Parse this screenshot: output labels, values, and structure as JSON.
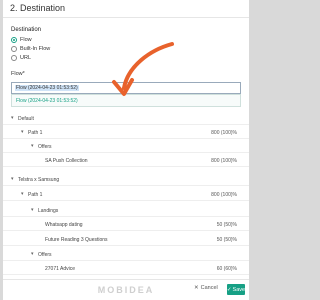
{
  "header": {
    "title": "2. Destination"
  },
  "destination": {
    "label": "Destination",
    "options": [
      {
        "label": "Flow",
        "checked": true
      },
      {
        "label": "Built-In Flow",
        "checked": false
      },
      {
        "label": "URL",
        "checked": false
      }
    ]
  },
  "flow": {
    "label": "Flow*",
    "selected": "Flow (2024-04-23 01:53:52)",
    "dropdown_option": "Flow (2024-04-23 01:53:52)"
  },
  "tree": [
    {
      "label": "Default",
      "value": ""
    },
    {
      "label": "Path 1",
      "value": "800 (100)%"
    },
    {
      "label": "Offers",
      "value": ""
    },
    {
      "label": "SA Push Collection",
      "value": "800 (100)%"
    },
    {
      "label": "Telstra x Samsung",
      "value": ""
    },
    {
      "label": "Path 1",
      "value": "800 (100)%"
    },
    {
      "label": "Landings",
      "value": ""
    },
    {
      "label": "Whatsapp dating",
      "value": "50 (50)%"
    },
    {
      "label": "Future Reading 3 Questions",
      "value": "50 (50)%"
    },
    {
      "label": "Offers",
      "value": ""
    },
    {
      "label": "27071 Advice",
      "value": "60 (60)%"
    }
  ],
  "footer": {
    "cancel": "Cancel",
    "save": "Save"
  },
  "watermark": "MOBIDEA",
  "colors": {
    "accent": "#16a085",
    "arrow": "#e8622c"
  }
}
